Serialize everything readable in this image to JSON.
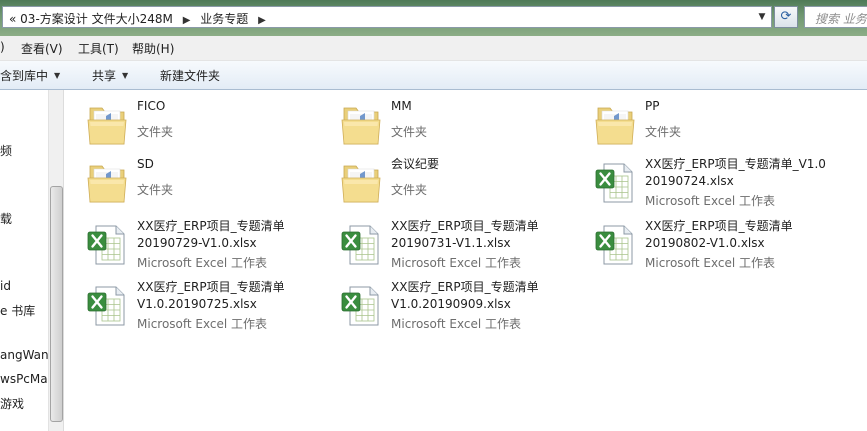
{
  "address_bar": {
    "breadcrumbs": [
      "03-方案设计 文件大小248M",
      "业务专题"
    ],
    "search_placeholder": "搜索 业务"
  },
  "menu": [
    "查看(V)",
    "工具(T)",
    "帮助(H)"
  ],
  "menu_partial_left": ")",
  "toolbar": {
    "include_library": "含到库中",
    "share": "共享",
    "new_folder": "新建文件夹"
  },
  "nav_items": [
    "频",
    "载",
    "id",
    "e 书库",
    "angWan",
    "wsPcMa",
    "游戏"
  ],
  "files": [
    {
      "name": "FICO",
      "type": "文件夹",
      "kind": "folder"
    },
    {
      "name": "MM",
      "type": "文件夹",
      "kind": "folder"
    },
    {
      "name": "PP",
      "type": "文件夹",
      "kind": "folder"
    },
    {
      "name": "SD",
      "type": "文件夹",
      "kind": "folder"
    },
    {
      "name": "会议纪要",
      "type": "文件夹",
      "kind": "folder"
    },
    {
      "name_line1": "XX医疗_ERP项目_专题清单_V1.0",
      "name_line2": "20190724.xlsx",
      "type": "Microsoft Excel 工作表",
      "kind": "excel"
    },
    {
      "name_line1": "XX医疗_ERP项目_专题清单",
      "name_line2": "20190729-V1.0.xlsx",
      "type": "Microsoft Excel 工作表",
      "kind": "excel"
    },
    {
      "name_line1": "XX医疗_ERP项目_专题清单",
      "name_line2": "20190731-V1.1.xlsx",
      "type": "Microsoft Excel 工作表",
      "kind": "excel"
    },
    {
      "name_line1": "XX医疗_ERP项目_专题清单",
      "name_line2": "20190802-V1.0.xlsx",
      "type": "Microsoft Excel 工作表",
      "kind": "excel"
    },
    {
      "name_line1": "XX医疗_ERP项目_专题清单",
      "name_line2": "V1.0.20190725.xlsx",
      "type": "Microsoft Excel 工作表",
      "kind": "excel"
    },
    {
      "name_line1": "XX医疗_ERP项目_专题清单",
      "name_line2": "V1.0.20190909.xlsx",
      "type": "Microsoft Excel 工作表",
      "kind": "excel"
    }
  ]
}
